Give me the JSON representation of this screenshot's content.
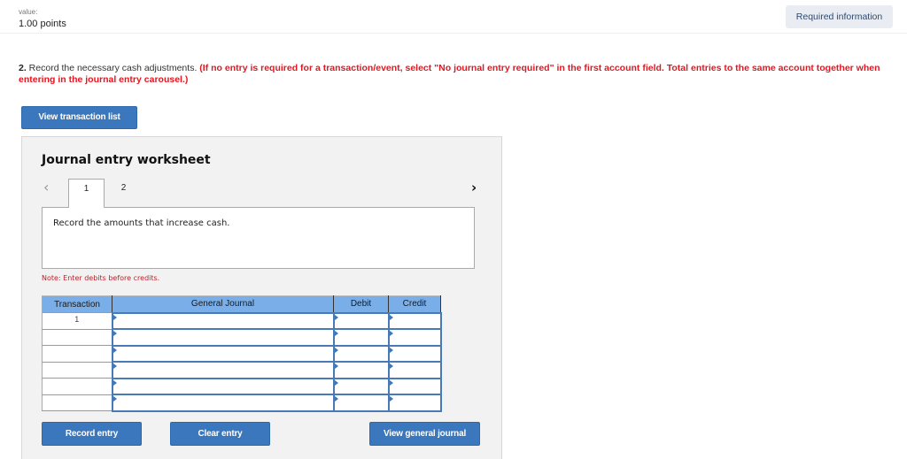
{
  "header": {
    "value_label": "value:",
    "points": "1.00 points",
    "required_info_button": "Required information"
  },
  "question": {
    "number": "2.",
    "text": " Record the necessary cash adjustments. ",
    "instruction": "(If no entry is required for a transaction/event, select \"No journal entry required\" in the first account field. Total entries to the same account together when entering in the journal entry carousel.)"
  },
  "view_transaction_list_button": "View transaction list",
  "worksheet": {
    "title": "Journal entry worksheet",
    "prev_icon": "chevron-left-icon",
    "next_icon": "chevron-right-icon",
    "tabs": [
      {
        "label": "1",
        "active": true
      },
      {
        "label": "2",
        "active": false
      }
    ],
    "instruction_text": "Record the amounts that increase cash.",
    "note": "Note: Enter debits before credits.",
    "table": {
      "headers": [
        "Transaction",
        "General Journal",
        "Debit",
        "Credit"
      ],
      "rows": [
        {
          "transaction": "1",
          "account": "",
          "debit": "",
          "credit": ""
        },
        {
          "transaction": "",
          "account": "",
          "debit": "",
          "credit": ""
        },
        {
          "transaction": "",
          "account": "",
          "debit": "",
          "credit": ""
        },
        {
          "transaction": "",
          "account": "",
          "debit": "",
          "credit": ""
        },
        {
          "transaction": "",
          "account": "",
          "debit": "",
          "credit": ""
        },
        {
          "transaction": "",
          "account": "",
          "debit": "",
          "credit": ""
        }
      ]
    },
    "buttons": {
      "record": "Record entry",
      "clear": "Clear entry",
      "view_general_journal": "View general journal"
    }
  },
  "colors": {
    "accent_button": "#3a77bd",
    "table_header": "#7aaee8",
    "instruction_red": "#e8141e",
    "note_red": "#b8232c"
  }
}
